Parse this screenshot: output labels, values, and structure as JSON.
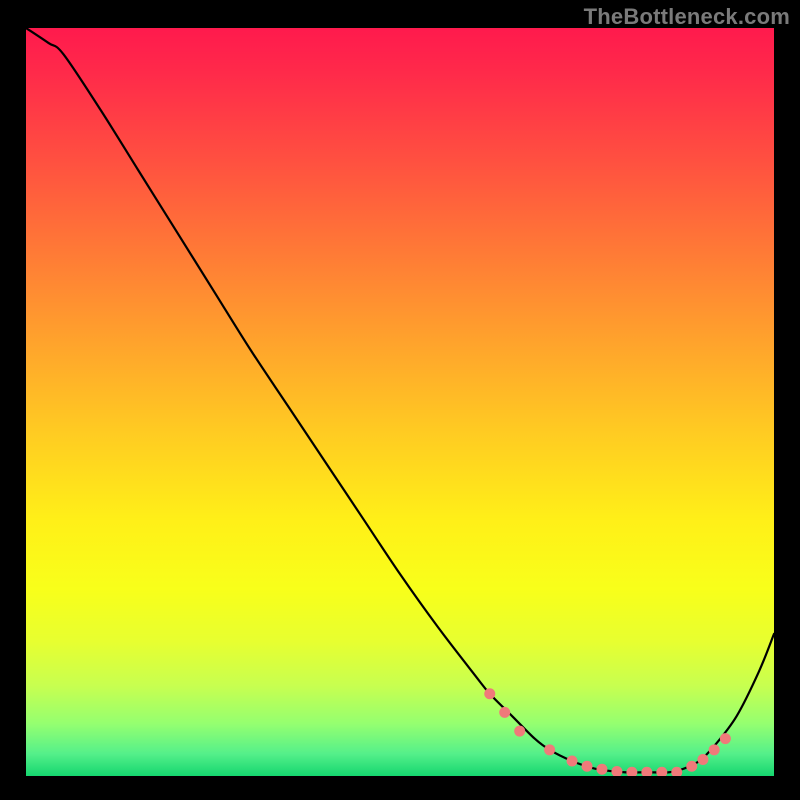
{
  "watermark": "TheBottleneck.com",
  "chart_data": {
    "type": "line",
    "title": "",
    "xlabel": "",
    "ylabel": "",
    "xlim": [
      0,
      100
    ],
    "ylim": [
      0,
      100
    ],
    "grid": false,
    "legend": false,
    "series": [
      {
        "name": "curve",
        "x": [
          0,
          3,
          5,
          10,
          15,
          20,
          25,
          30,
          35,
          40,
          45,
          50,
          55,
          60,
          62,
          65,
          68,
          70,
          73,
          76,
          80,
          83,
          86,
          88,
          90,
          92,
          95,
          98,
          100
        ],
        "y": [
          100,
          98,
          96.5,
          89,
          81,
          73,
          65,
          57,
          49.5,
          42,
          34.5,
          27,
          20,
          13.5,
          11,
          8,
          5,
          3.5,
          2,
          1,
          0.5,
          0.5,
          0.5,
          1,
          2,
          4,
          8,
          14,
          19
        ]
      }
    ],
    "annotations": {
      "dot_color": "#f07a7a",
      "dots_x": [
        62,
        64,
        66,
        70,
        73,
        75,
        77,
        79,
        81,
        83,
        85,
        87,
        89,
        90.5,
        92,
        93.5
      ],
      "dots_y": [
        11,
        8.5,
        6,
        3.5,
        2,
        1.3,
        0.9,
        0.6,
        0.5,
        0.5,
        0.5,
        0.5,
        1.3,
        2.2,
        3.5,
        5
      ]
    },
    "background_gradient": {
      "stops": [
        {
          "offset": 0.0,
          "color": "#ff1a4d"
        },
        {
          "offset": 0.06,
          "color": "#ff2a4a"
        },
        {
          "offset": 0.18,
          "color": "#ff5140"
        },
        {
          "offset": 0.3,
          "color": "#ff7a36"
        },
        {
          "offset": 0.42,
          "color": "#ffa32c"
        },
        {
          "offset": 0.54,
          "color": "#ffcb22"
        },
        {
          "offset": 0.66,
          "color": "#fff018"
        },
        {
          "offset": 0.75,
          "color": "#f8ff1a"
        },
        {
          "offset": 0.82,
          "color": "#e7ff30"
        },
        {
          "offset": 0.88,
          "color": "#c7ff50"
        },
        {
          "offset": 0.93,
          "color": "#95ff70"
        },
        {
          "offset": 0.97,
          "color": "#55f08a"
        },
        {
          "offset": 1.0,
          "color": "#15d66f"
        }
      ]
    }
  }
}
